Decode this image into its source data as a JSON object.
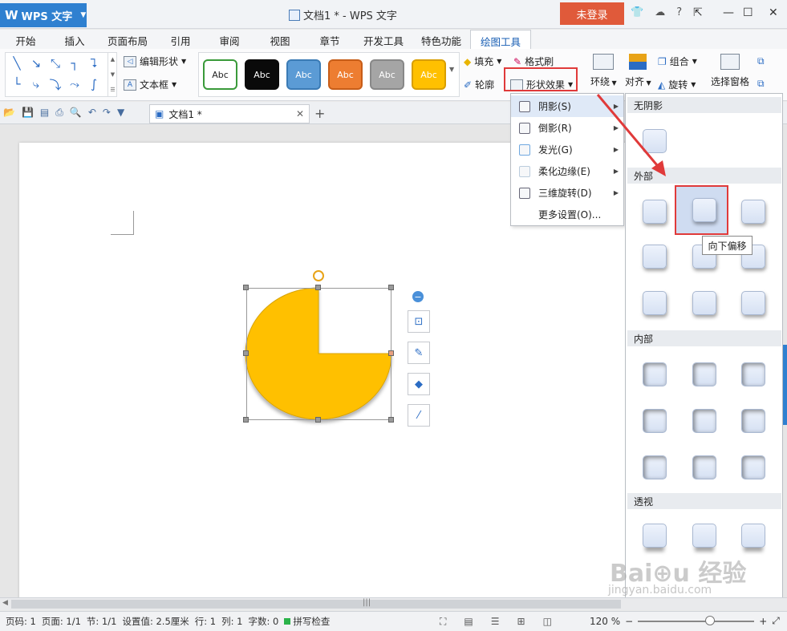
{
  "app": {
    "name": "WPS 文字",
    "title": "文档1 * - WPS 文字",
    "login": "未登录"
  },
  "tabs": [
    "开始",
    "插入",
    "页面布局",
    "引用",
    "审阅",
    "视图",
    "章节",
    "开发工具",
    "特色功能",
    "绘图工具"
  ],
  "ribbon": {
    "edit_shape": "编辑形状",
    "textbox": "文本框",
    "styles": [
      {
        "label": "Abc",
        "bg": "#ffffff",
        "fg": "#222222",
        "border": "#3a9a3a"
      },
      {
        "label": "Abc",
        "bg": "#0a0a0a",
        "fg": "#ffffff",
        "border": "#0a0a0a"
      },
      {
        "label": "Abc",
        "bg": "#5b9bd5",
        "fg": "#ffffff",
        "border": "#3b7bb5"
      },
      {
        "label": "Abc",
        "bg": "#ed7d31",
        "fg": "#ffffff",
        "border": "#c75d18"
      },
      {
        "label": "Abc",
        "bg": "#a5a5a5",
        "fg": "#ffffff",
        "border": "#888888"
      },
      {
        "label": "Abc",
        "bg": "#ffc000",
        "fg": "#ffffff",
        "border": "#d89e00"
      }
    ],
    "fill": "填充",
    "format_painter": "格式刷",
    "outline": "轮廓",
    "shape_effects": "形状效果",
    "wrap": "环绕",
    "align": "对齐",
    "group": "组合",
    "rotate": "旋转",
    "selection_pane": "选择窗格"
  },
  "document_tab": {
    "name": "文档1 *"
  },
  "shape_effects_menu": [
    {
      "label": "阴影(S)",
      "submenu": true
    },
    {
      "label": "倒影(R)",
      "submenu": true
    },
    {
      "label": "发光(G)",
      "submenu": true
    },
    {
      "label": "柔化边缘(E)",
      "submenu": true
    },
    {
      "label": "三维旋转(D)",
      "submenu": true
    },
    {
      "label": "更多设置(O)...",
      "submenu": false
    }
  ],
  "shadow_gallery": {
    "sections": [
      "无阴影",
      "外部",
      "内部",
      "透视"
    ],
    "tooltip": "向下偏移"
  },
  "shape": {
    "fill": "#ffc000",
    "type": "pie"
  },
  "statusbar": {
    "page_num": "页码: 1",
    "pages": "页面: 1/1",
    "section": "节: 1/1",
    "setting": "设置值: 2.5厘米",
    "row": "行: 1",
    "col": "列: 1",
    "words": "字数: 0",
    "spell": "拼写检查",
    "zoom": "120 %"
  },
  "colors": {
    "accent": "#2f80d0",
    "highlight": "#e03a3a",
    "login": "#e05a3a"
  }
}
